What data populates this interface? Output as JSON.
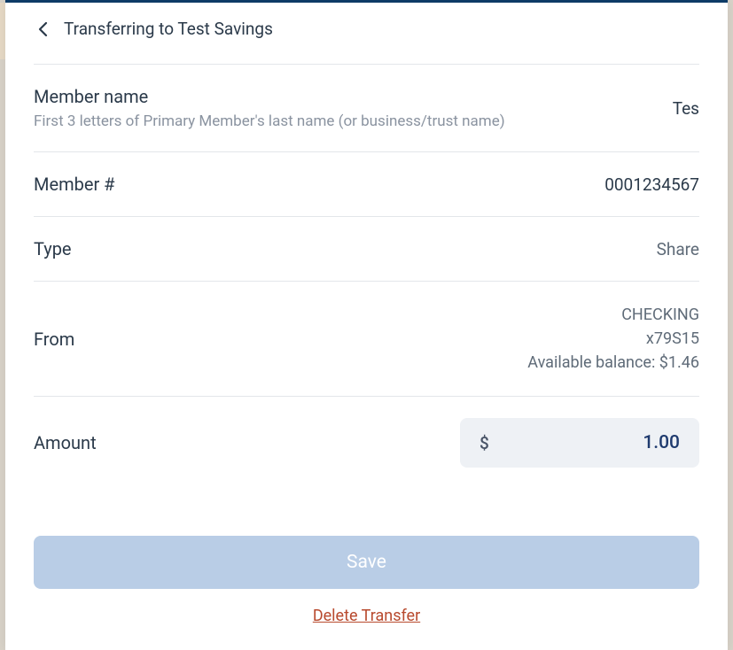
{
  "header": {
    "title": "Transferring to Test Savings"
  },
  "rows": {
    "memberName": {
      "label": "Member name",
      "sub": "First 3 letters of Primary Member's last name (or business/trust name)",
      "value": "Tes"
    },
    "memberNumber": {
      "label": "Member #",
      "value": "0001234567"
    },
    "type": {
      "label": "Type",
      "value": "Share"
    },
    "from": {
      "label": "From",
      "account": "CHECKING",
      "suffix": "x79S15",
      "balance": "Available balance: $1.46"
    },
    "amount": {
      "label": "Amount",
      "symbol": "$",
      "value": "1.00"
    }
  },
  "footer": {
    "save": "Save",
    "delete": "Delete Transfer"
  }
}
